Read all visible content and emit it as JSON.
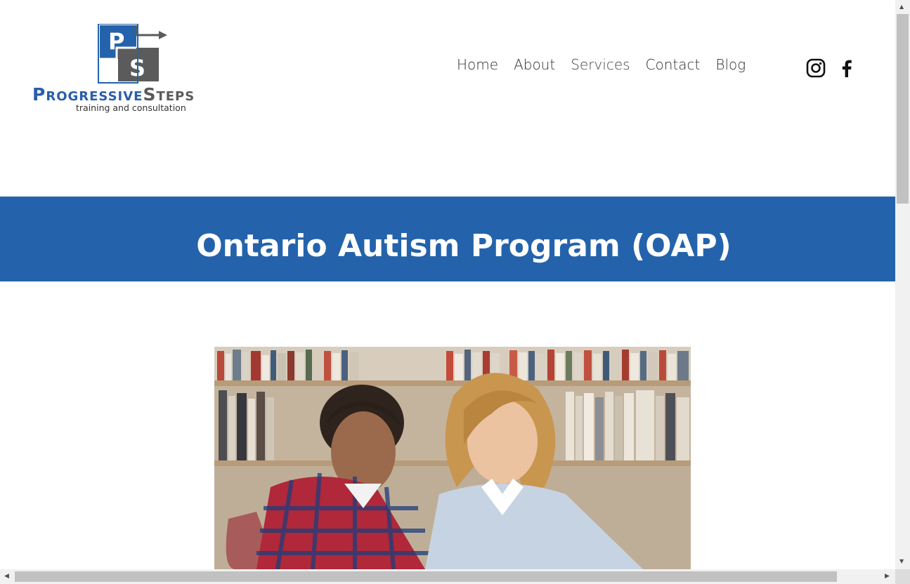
{
  "logo": {
    "letters": [
      "P",
      "S"
    ],
    "wordmark_p": "P",
    "wordmark_rogressive": "ROGRESSIVE",
    "wordmark_s": "S",
    "wordmark_teps": "TEPS",
    "tagline": "training and consultation",
    "colors": {
      "blue": "#2a5ea8",
      "grey": "#5a5a5a"
    }
  },
  "nav": {
    "items": [
      {
        "label": "Home"
      },
      {
        "label": "About"
      },
      {
        "label": "Services"
      },
      {
        "label": "Contact"
      },
      {
        "label": "Blog"
      }
    ],
    "social": [
      "instagram-icon",
      "facebook-icon"
    ]
  },
  "banner": {
    "title": "Ontario Autism Program (OAP)",
    "background": "#2463ab"
  },
  "photo": {
    "subject": "tutor-and-student-photo"
  },
  "scrollbar": {
    "vertical_position": 0.0,
    "horizontal_position": 0.0
  }
}
